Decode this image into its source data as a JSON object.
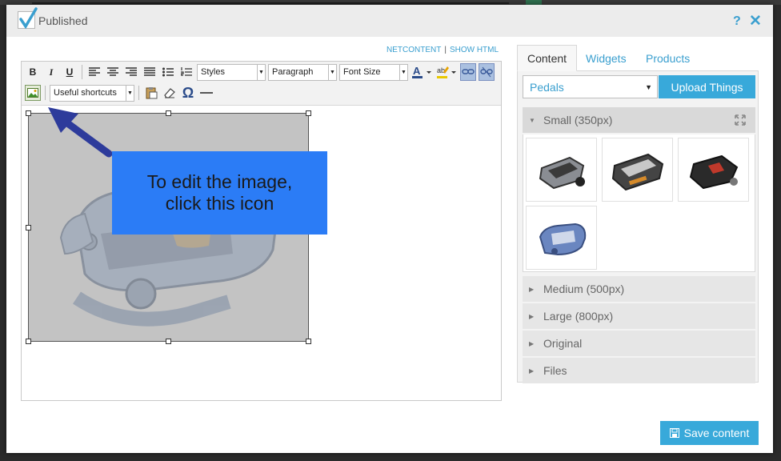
{
  "header": {
    "published_label": "Published",
    "help_label": "?",
    "close_label": "✕"
  },
  "editor": {
    "mode_links": {
      "netcontent": "NETCONTENT",
      "show_html": "SHOW HTML"
    },
    "toolbar": {
      "bold": "B",
      "italic": "I",
      "underline": "U",
      "styles": "Styles",
      "paragraph": "Paragraph",
      "font_size": "Font Size",
      "shortcuts": "Useful shortcuts",
      "omega": "Ω"
    },
    "tooltip": "To edit the image,\nclick this icon"
  },
  "sidebar": {
    "tabs": [
      "Content",
      "Widgets",
      "Products"
    ],
    "folder_select": "Pedals",
    "upload_label": "Upload Things",
    "sections": {
      "small": "Small (350px)",
      "medium": "Medium (500px)",
      "large": "Large (800px)",
      "original": "Original",
      "files": "Files"
    }
  },
  "footer": {
    "save_label": "Save content"
  },
  "colors": {
    "accent": "#38a9da",
    "link": "#3a9fcf",
    "tooltip_bg": "#2b7cf6",
    "arrow": "#2d3b9b"
  }
}
